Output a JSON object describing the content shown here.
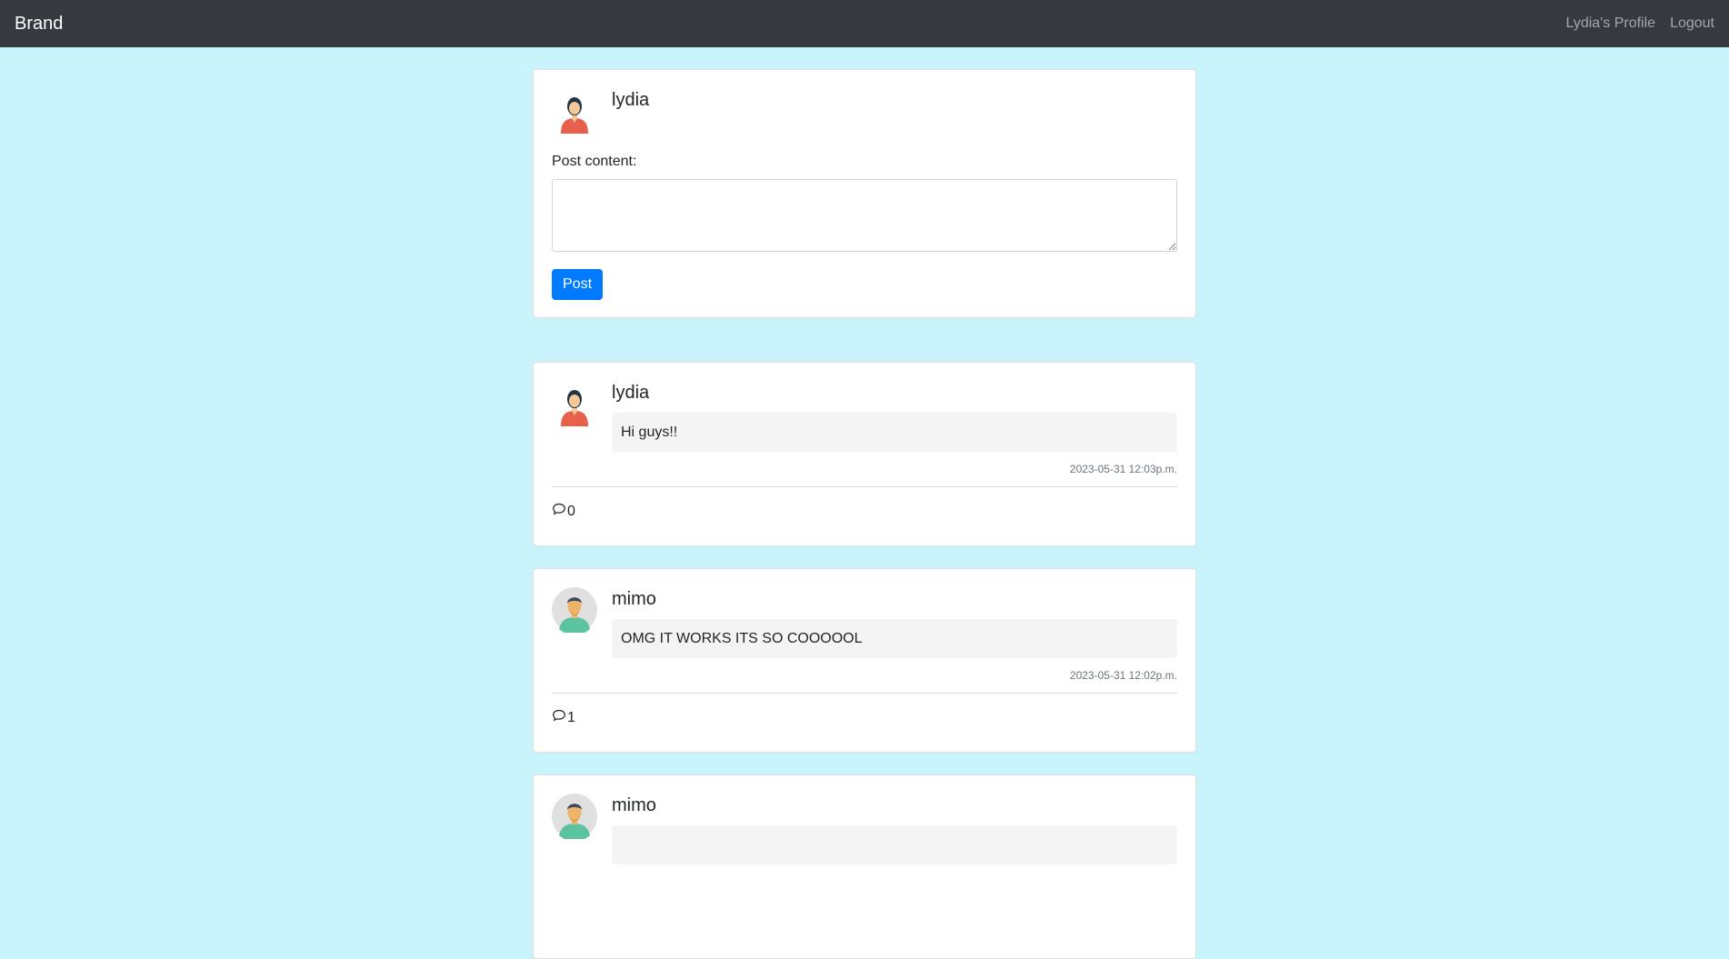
{
  "navbar": {
    "brand": "Brand",
    "profile_link": "Lydia's Profile",
    "logout_link": "Logout"
  },
  "compose": {
    "username": "lydia",
    "content_label": "Post content:",
    "content_value": "",
    "post_button": "Post"
  },
  "posts": [
    {
      "username": "lydia",
      "content": "Hi guys!!",
      "timestamp": "2023-05-31 12:03p.m.",
      "comment_count": "0"
    },
    {
      "username": "mimo",
      "content": "OMG IT WORKS ITS SO COOOOOL",
      "timestamp": "2023-05-31 12:02p.m.",
      "comment_count": "1"
    },
    {
      "username": "mimo",
      "content": "",
      "timestamp": "",
      "comment_count": ""
    }
  ],
  "colors": {
    "navbar_bg": "#343a40",
    "page_bg": "#c8f3fb",
    "primary_button": "#007bff"
  },
  "icons": {
    "female_avatar": "avatar-female-icon",
    "male_avatar": "avatar-male-icon",
    "comment": "comment-bubble-icon"
  }
}
